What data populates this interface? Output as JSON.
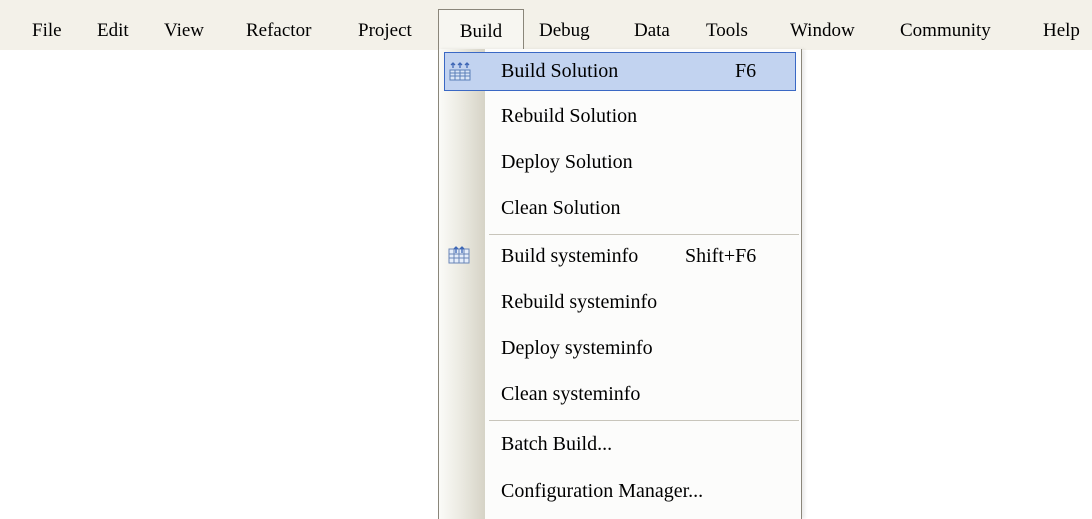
{
  "menubar": {
    "items": [
      {
        "label": "File"
      },
      {
        "label": "Edit"
      },
      {
        "label": "View"
      },
      {
        "label": "Refactor"
      },
      {
        "label": "Project"
      },
      {
        "label": "Build"
      },
      {
        "label": "Debug"
      },
      {
        "label": "Data"
      },
      {
        "label": "Tools"
      },
      {
        "label": "Window"
      },
      {
        "label": "Community"
      },
      {
        "label": "Help"
      }
    ]
  },
  "build_menu": {
    "items": [
      {
        "label": "Build Solution",
        "shortcut": "F6",
        "icon": "build-icon",
        "highlighted": true
      },
      {
        "label": "Rebuild Solution"
      },
      {
        "label": "Deploy Solution"
      },
      {
        "label": "Clean Solution"
      },
      {
        "label": "Build systeminfo",
        "shortcut": "Shift+F6",
        "icon": "build-project-icon"
      },
      {
        "label": "Rebuild systeminfo"
      },
      {
        "label": "Deploy systeminfo"
      },
      {
        "label": "Clean systeminfo"
      },
      {
        "label": "Batch Build..."
      },
      {
        "label": "Configuration Manager..."
      }
    ]
  },
  "colors": {
    "menubar_bg": "#f3f1e9",
    "highlight_bg": "#c2d3f0",
    "highlight_border": "#3a68c4"
  }
}
